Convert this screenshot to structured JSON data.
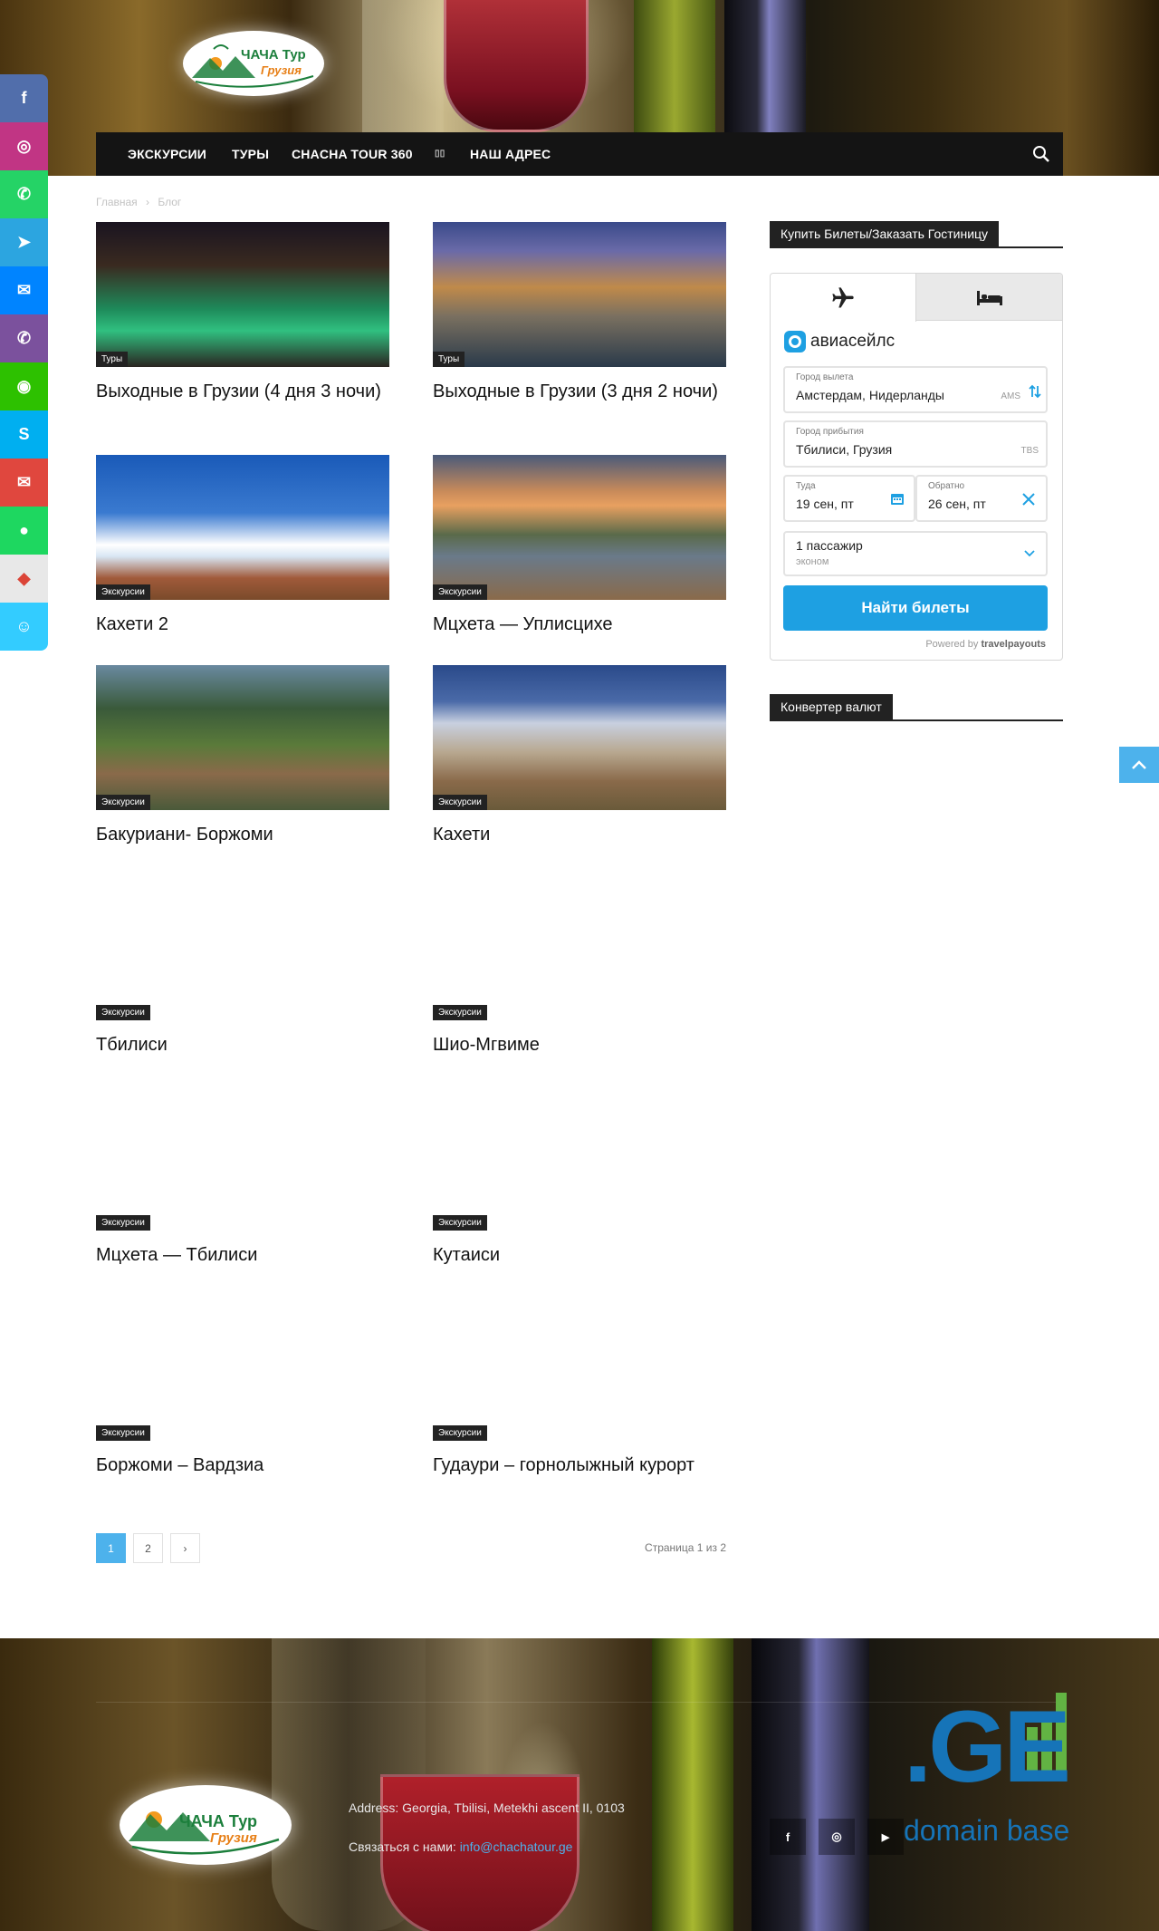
{
  "header": {
    "logo_main": "ЧАЧА Тур",
    "logo_sub": "Грузия",
    "nav": [
      {
        "label": "ЭКСКУРСИИ"
      },
      {
        "label": "ТУРЫ"
      },
      {
        "label": "CHACHA TOUR 360"
      },
      {
        "label": "▯▯"
      },
      {
        "label": "НАШ АДРЕС"
      }
    ]
  },
  "social_sidebar": [
    {
      "icon": "facebook-icon",
      "glyph": "f",
      "color": "#516eab"
    },
    {
      "icon": "instagram-icon",
      "glyph": "◎",
      "color": "#c13584"
    },
    {
      "icon": "whatsapp-icon",
      "glyph": "✆",
      "color": "#25d366"
    },
    {
      "icon": "telegram-icon",
      "glyph": "➤",
      "color": "#2ca5e0"
    },
    {
      "icon": "messenger-icon",
      "glyph": "✉",
      "color": "#0084ff"
    },
    {
      "icon": "viber-icon",
      "glyph": "✆",
      "color": "#7b519d"
    },
    {
      "icon": "wechat-icon",
      "glyph": "◉",
      "color": "#2dc100"
    },
    {
      "icon": "skype-icon",
      "glyph": "S",
      "color": "#00aff0"
    },
    {
      "icon": "email-icon",
      "glyph": "✉",
      "color": "#e0473e"
    },
    {
      "icon": "location-icon",
      "glyph": "●",
      "color": "#1ed760"
    },
    {
      "icon": "google-maps-icon",
      "glyph": "◆",
      "color": "#e8e8e8"
    },
    {
      "icon": "waze-icon",
      "glyph": "☺",
      "color": "#33ccff"
    }
  ],
  "breadcrumb": {
    "home": "Главная",
    "sep": "›",
    "current": "Блог"
  },
  "posts": [
    {
      "title": "Выходные в Грузии (4 дня 3 ночи)",
      "category": "Туры"
    },
    {
      "title": "Выходные в Грузии (3 дня 2 ночи)",
      "category": "Туры"
    },
    {
      "title": "Кахети 2",
      "category": "Экскурсии"
    },
    {
      "title": "Мцхета — Уплисцихе",
      "category": "Экскурсии"
    },
    {
      "title": "Бакуриани- Боржоми",
      "category": "Экскурсии"
    },
    {
      "title": "Кахети",
      "category": "Экскурсии"
    },
    {
      "title": "Тбилиси",
      "category": "Экскурсии"
    },
    {
      "title": "Шио-Мгвиме",
      "category": "Экскурсии"
    },
    {
      "title": "Мцхета — Тбилиси",
      "category": "Экскурсии"
    },
    {
      "title": "Кутаиси",
      "category": "Экскурсии"
    },
    {
      "title": "Боржоми – Вардзиа",
      "category": "Экскурсии"
    },
    {
      "title": "Гудаури – горнолыжный курорт",
      "category": "Экскурсии"
    }
  ],
  "pagination": {
    "page1": "1",
    "page2": "2",
    "next": "›",
    "info": "Страница 1 из 2"
  },
  "sidebar": {
    "widget1_title": "Купить Билеты/Заказать Гостиницу",
    "widget2_title": "Конвертер валют",
    "avia": {
      "brand": "авиасейлс",
      "from_label": "Город вылета",
      "from_value": "Амстердам, Нидерланды",
      "from_code": "AMS",
      "to_label": "Город прибытия",
      "to_value": "Тбилиси, Грузия",
      "to_code": "TBS",
      "depart_label": "Туда",
      "depart_value": "19 сен, пт",
      "return_label": "Обратно",
      "return_value": "26 сен, пт",
      "passengers": "1 пассажир",
      "class": "эконом",
      "search_button": "Найти билеты",
      "powered_prefix": "Powered by",
      "powered_brand": "travelpayouts"
    }
  },
  "footer": {
    "address": "Address: Georgia, Tbilisi, Metekhi ascent II, 0103",
    "contact_prefix": "Связаться с нами:",
    "email": "info@chachatour.ge",
    "ge_logo": ".GE",
    "ge_sub": "domain base",
    "social": [
      "f",
      "◎",
      "▶"
    ]
  },
  "colors": {
    "accent": "#4db2ec",
    "nav_bg": "#141414",
    "avia_button": "#1ea0e2"
  }
}
